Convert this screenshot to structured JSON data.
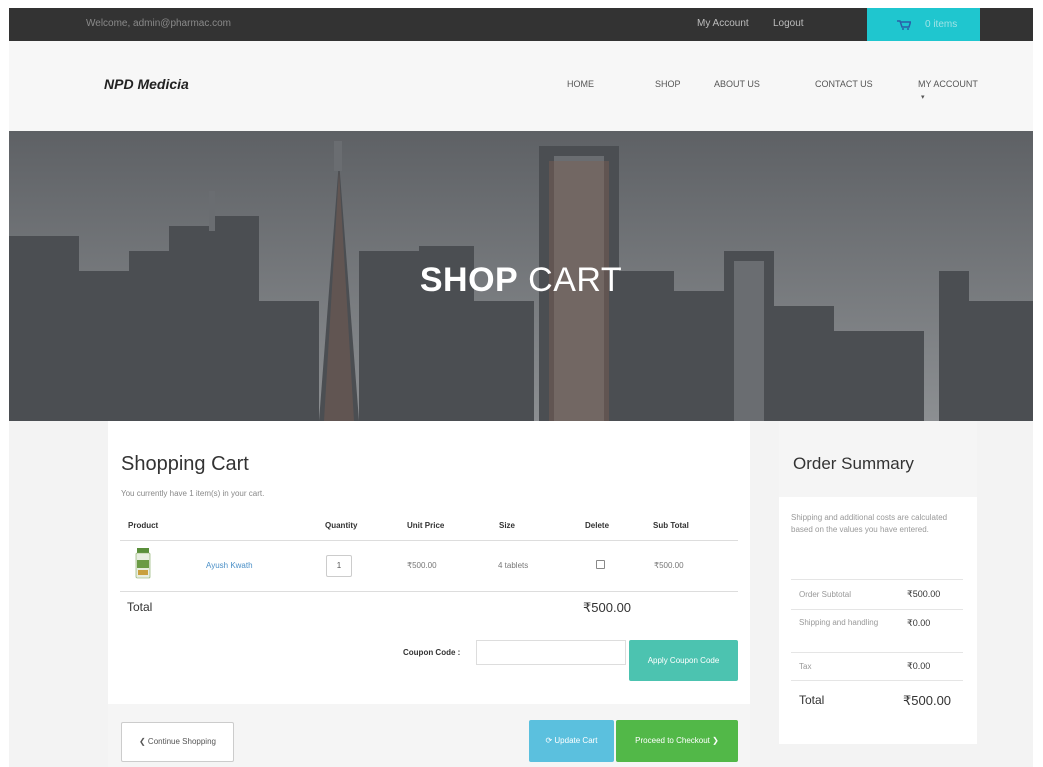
{
  "topbar": {
    "welcome": "Welcome, admin@pharmac.com",
    "my_account": "My Account",
    "logout": "Logout",
    "cart_label": "0 items",
    "cart_icon": "shopping-cart-icon"
  },
  "nav": {
    "brand": "NPD Medicia",
    "items": [
      "HOME",
      "SHOP",
      "ABOUT US",
      "CONTACT US",
      "MY ACCOUNT"
    ],
    "caret": "▾"
  },
  "hero": {
    "title_bold": "SHOP",
    "title_rest": " CART"
  },
  "cart": {
    "title": "Shopping Cart",
    "subtitle": "You currently have 1 item(s) in your cart.",
    "headers": {
      "product": "Product",
      "quantity": "Quantity",
      "unit_price": "Unit Price",
      "size": "Size",
      "delete": "Delete",
      "sub_total": "Sub Total"
    },
    "row": {
      "name": "Ayush Kwath",
      "quantity": "1",
      "unit_price": "₹500.00",
      "size": "4 tablets",
      "sub_total": "₹500.00"
    },
    "total_label": "Total",
    "total_value": "₹500.00",
    "coupon_label": "Coupon Code :",
    "apply_button": "Apply Coupon Code",
    "continue_button": "❮ Continue Shopping",
    "update_button": "⟳ Update Cart",
    "checkout_button": "Proceed to Checkout ❯"
  },
  "summary": {
    "title": "Order Summary",
    "note": "Shipping and additional costs are calculated based on the values you have entered.",
    "rows": [
      {
        "label": "Order Subtotal",
        "value": "₹500.00"
      },
      {
        "label": "Shipping and handling",
        "value": "₹0.00"
      },
      {
        "label": "Tax",
        "value": "₹0.00"
      }
    ],
    "total_label": "Total",
    "total_value": "₹500.00"
  },
  "colors": {
    "topbar": "#333333",
    "cart_accent": "#1fc6cf",
    "apply": "#4cc3b0",
    "update": "#5bc0de",
    "checkout": "#52b848"
  }
}
